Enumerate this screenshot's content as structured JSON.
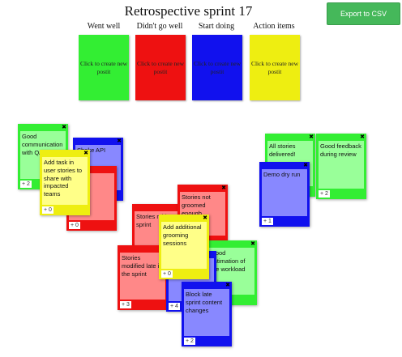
{
  "header": {
    "title": "Retrospective sprint 17",
    "export_label": "Export to CSV"
  },
  "columns": [
    {
      "label": "Went well",
      "create_label": "Click to create new postit",
      "color": "#33ee33"
    },
    {
      "label": "Didn't go well",
      "create_label": "Click to create new postit",
      "color": "#ee1111"
    },
    {
      "label": "Start doing",
      "create_label": "Click to create new postit",
      "color": "#1111ee"
    },
    {
      "label": "Action items",
      "create_label": "Click to create new postit",
      "color": "#eeee11"
    }
  ],
  "postits": [
    {
      "text": "Good communication with QA",
      "votes": "+ 2",
      "color": "green"
    },
    {
      "text": "Shake API",
      "votes": "",
      "color": "blue"
    },
    {
      "text": "Add task in user stories to share with impacted teams",
      "votes": "+ 0",
      "color": "yellow"
    },
    {
      "text": "",
      "votes": "+ 0",
      "color": "red"
    },
    {
      "text": "All stories delivered!",
      "votes": "",
      "color": "green"
    },
    {
      "text": "Good feedback during review",
      "votes": "+ 2",
      "color": "green"
    },
    {
      "text": "Demo dry run",
      "votes": "+ 1",
      "color": "blue"
    },
    {
      "text": "Stories not groomed enough",
      "votes": "",
      "color": "red"
    },
    {
      "text": "Stories mid-sprint",
      "votes": "",
      "color": "red"
    },
    {
      "text": "Add additional grooming sessions",
      "votes": "+ 0",
      "color": "yellow"
    },
    {
      "text": "Good estimation of the workload",
      "votes": "",
      "color": "green"
    },
    {
      "text": "Stories modified late in the sprint",
      "votes": "+ 3",
      "color": "red"
    },
    {
      "text": "",
      "votes": "+ 4",
      "color": "blue"
    },
    {
      "text": "Block late sprint content changes",
      "votes": "+ 2",
      "color": "blue"
    }
  ],
  "close_symbol": "✖"
}
